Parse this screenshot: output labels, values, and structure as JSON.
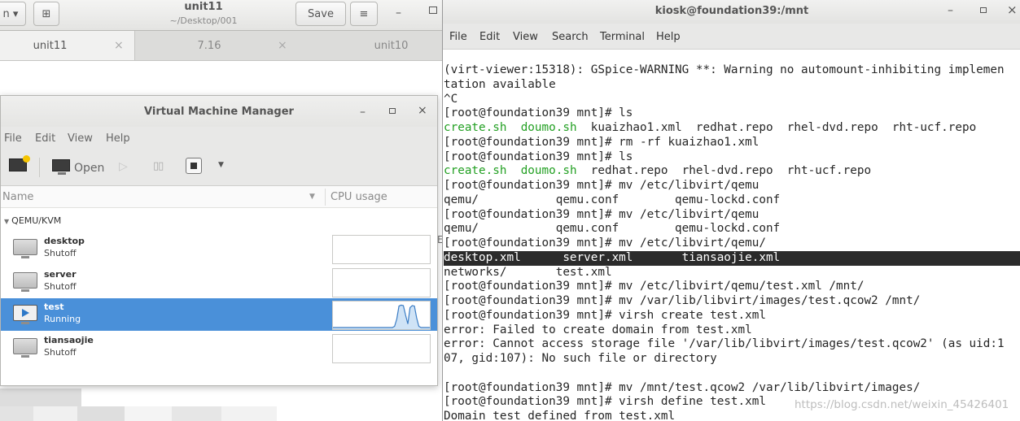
{
  "editor": {
    "title": "unit11",
    "path": "~/Desktop/001",
    "save_label": "Save",
    "open_glyph": "n ▾",
    "newtab_glyph": "⊞",
    "menu_glyph": "≡",
    "min_glyph": "–",
    "tabs": [
      {
        "label": "unit11",
        "close": "×"
      },
      {
        "label": "7.16",
        "close": "×"
      },
      {
        "label": "unit10"
      }
    ]
  },
  "vmm": {
    "title": "Virtual Machine Manager",
    "min_glyph": "–",
    "close_glyph": "×",
    "menu": [
      "File",
      "Edit",
      "View",
      "Help"
    ],
    "toolbar": {
      "open_label": "Open",
      "run_glyph": "▷",
      "pause_glyph": "▯▯",
      "dropdown_glyph": "▼"
    },
    "columns": {
      "name": "Name",
      "sort_glyph": "▼",
      "cpu": "CPU usage"
    },
    "group": {
      "name": "QEMU/KVM",
      "glyph": "▼"
    },
    "edge_glyph": "E",
    "vms": [
      {
        "name": "desktop",
        "state": "Shutoff"
      },
      {
        "name": "server",
        "state": "Shutoff"
      },
      {
        "name": "test",
        "state": "Running",
        "cpu_usage": [
          0,
          0,
          0,
          0,
          0,
          0,
          0,
          0,
          0,
          0,
          0,
          0,
          0,
          0,
          0,
          0,
          0,
          0,
          0,
          0,
          0,
          0,
          0,
          0,
          0,
          0,
          0,
          0,
          0.05,
          0.35,
          0.88,
          0.92,
          0.9,
          0.5,
          0.15,
          0.82,
          0.9,
          0.88,
          0.4,
          0.05,
          0,
          0,
          0,
          0,
          0
        ]
      },
      {
        "name": "tiansaojie",
        "state": "Shutoff"
      }
    ]
  },
  "terminal": {
    "title": "kiosk@foundation39:/mnt",
    "min_glyph": "–",
    "close_glyph": "×",
    "menu": [
      "File",
      "Edit",
      "View",
      "Search",
      "Terminal",
      "Help"
    ],
    "lines": [
      "(virt-viewer:15318): GSpice-WARNING **: Warning no automount-inhibiting implemen",
      "tation available",
      "^C",
      "[root@foundation39 mnt]# ls",
      "",
      "[root@foundation39 mnt]# rm -rf kuaizhao1.xml",
      "[root@foundation39 mnt]# ls",
      "",
      "[root@foundation39 mnt]# mv /etc/libvirt/qemu",
      "qemu/           qemu.conf        qemu-lockd.conf",
      "[root@foundation39 mnt]# mv /etc/libvirt/qemu",
      "qemu/           qemu.conf        qemu-lockd.conf",
      "[root@foundation39 mnt]# mv /etc/libvirt/qemu/",
      "desktop.xml      server.xml       tiansaojie.xml",
      "networks/       test.xml",
      "[root@foundation39 mnt]# mv /etc/libvirt/qemu/test.xml /mnt/",
      "[root@foundation39 mnt]# mv /var/lib/libvirt/images/test.qcow2 /mnt/",
      "[root@foundation39 mnt]# virsh create test.xml",
      "error: Failed to create domain from test.xml",
      "error: Cannot access storage file '/var/lib/libvirt/images/test.qcow2' (as uid:1",
      "07, gid:107): No such file or directory",
      "",
      "[root@foundation39 mnt]# mv /mnt/test.qcow2 /var/lib/libvirt/images/",
      "[root@foundation39 mnt]# virsh define test.xml",
      "Domain test defined from test.xml"
    ],
    "ls1": {
      "g1": "create.sh",
      "g2": "doumo.sh",
      "rest": "  kuaizhao1.xml  redhat.repo  rhel-dvd.repo  rht-ucf.repo"
    },
    "ls2": {
      "g1": "create.sh",
      "g2": "doumo.sh",
      "rest": "  redhat.repo  rhel-dvd.repo  rht-ucf.repo"
    },
    "watermark": "https://blog.csdn.net/weixin_45426401"
  }
}
